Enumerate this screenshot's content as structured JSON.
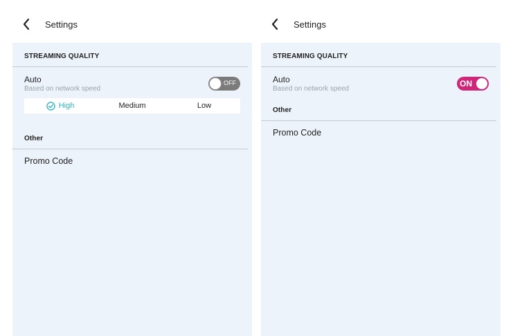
{
  "colors": {
    "panel_background": "#edf3fa",
    "toggle_on": "#d0267a",
    "toggle_off": "#7b7b7b",
    "selected_quality": "#2bb3c0"
  },
  "screens": [
    {
      "header": {
        "title": "Settings",
        "back_icon": "chevron-left-icon"
      },
      "streaming": {
        "heading": "STREAMING QUALITY",
        "auto_label": "Auto",
        "auto_sub": "Based on network speed",
        "toggle_state": "OFF",
        "quality_options": [
          "High",
          "Medium",
          "Low"
        ],
        "selected_quality": "High"
      },
      "other": {
        "heading": "Other",
        "promo_label": "Promo Code"
      }
    },
    {
      "header": {
        "title": "Settings",
        "back_icon": "chevron-left-icon"
      },
      "streaming": {
        "heading": "STREAMING QUALITY",
        "auto_label": "Auto",
        "auto_sub": "Based on network speed",
        "toggle_state": "ON"
      },
      "other": {
        "heading": "Other",
        "promo_label": "Promo Code"
      }
    }
  ]
}
